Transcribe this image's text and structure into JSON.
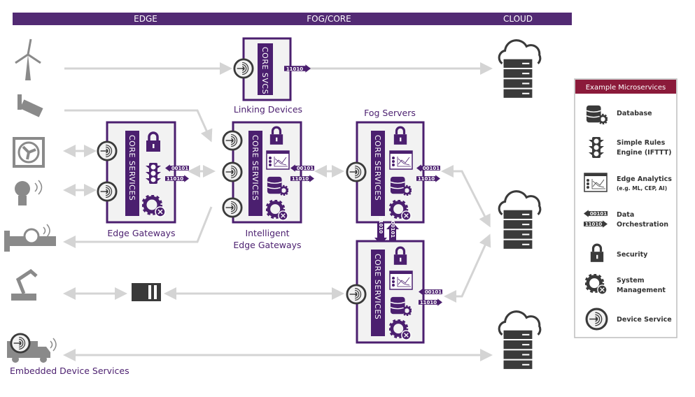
{
  "header": {
    "zones": [
      "EDGE",
      "FOG/CORE",
      "CLOUD"
    ],
    "color": "#522a73"
  },
  "nodes": {
    "linking": {
      "core_label": "CORE SVCS",
      "label": "Linking Devices"
    },
    "edge_gateways": {
      "core_label": "CORE SERVICES",
      "label": "Edge Gateways"
    },
    "intelligent": {
      "core_label": "CORE SERVICES",
      "label_line1": "Intelligent",
      "label_line2": "Edge Gateways"
    },
    "fog_servers": {
      "label": "Fog Servers",
      "core_label": "CORE SERVICES"
    },
    "fog_server_2": {
      "core_label": "CORE SERVICES"
    }
  },
  "bits": {
    "in": "00101",
    "out": "11010"
  },
  "devices": [
    "wind-turbine",
    "security-camera",
    "fan",
    "smart-bulb",
    "pipe-sensor",
    "robot-arm",
    "truck"
  ],
  "embedded_label": "Embedded Device Services",
  "legend": {
    "title": "Example Microservices",
    "header_color": "#8b1a3a",
    "items": [
      {
        "icon": "database",
        "line1": "Database"
      },
      {
        "icon": "traffic-light",
        "line1": "Simple Rules",
        "line2": "Engine (IFTTT)"
      },
      {
        "icon": "analytics",
        "line1": "Edge Analytics",
        "line2": "(e.g. ML, CEP, AI)"
      },
      {
        "icon": "data-orchestration",
        "line1": "Data",
        "line2": "Orchestration"
      },
      {
        "icon": "lock",
        "line1": "Security"
      },
      {
        "icon": "gear",
        "line1": "System",
        "line2": "Management"
      },
      {
        "icon": "device-service",
        "line1": "Device Service"
      }
    ]
  },
  "colors": {
    "accent": "#4b1f6f",
    "line": "#d4d4d4",
    "device": "#8a8a8a"
  }
}
